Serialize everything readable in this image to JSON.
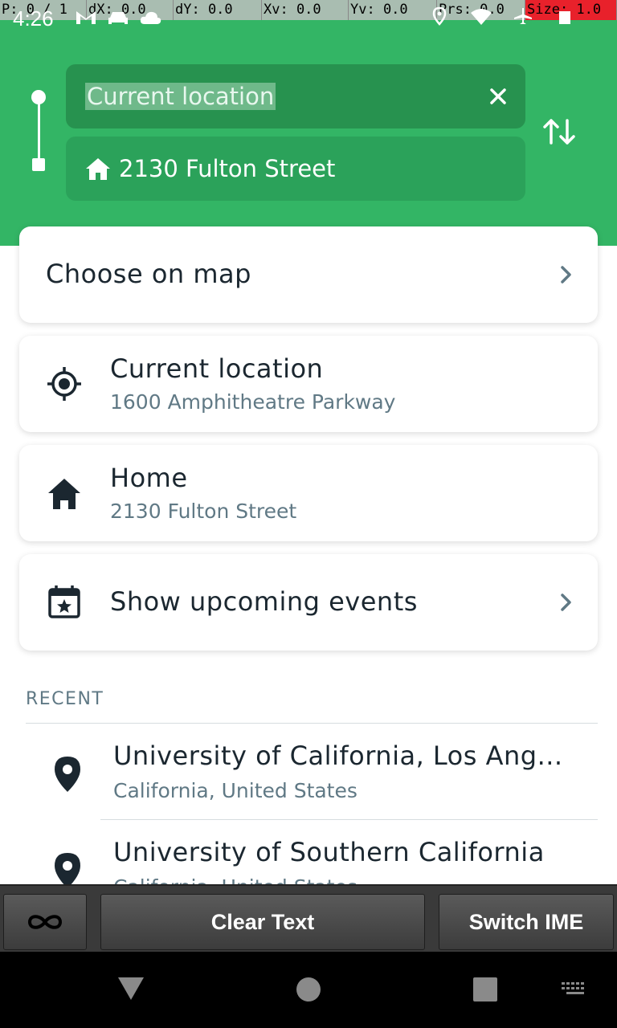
{
  "debug": {
    "pointer": "P: 0 / 1",
    "dx": "dX: 0.0",
    "dy": "dY: 0.0",
    "xv": "Xv: 0.0",
    "yv": "Yv: 0.0",
    "prs": "Prs: 0.0",
    "size": "Size: 1.0"
  },
  "status": {
    "time": "4:26"
  },
  "search": {
    "origin_value": "Current location",
    "destination_value": "2130 Fulton Street"
  },
  "cards": {
    "choose_on_map": "Choose on map",
    "current_location": {
      "title": "Current location",
      "subtitle": "1600 Amphitheatre Parkway"
    },
    "home": {
      "title": "Home",
      "subtitle": "2130 Fulton Street"
    },
    "events": "Show upcoming events"
  },
  "recent": {
    "header": "RECENT",
    "items": [
      {
        "title": "University of California, Los Ang...",
        "subtitle": "California, United States"
      },
      {
        "title": "University of Southern California",
        "subtitle": "California, United States"
      }
    ]
  },
  "ime": {
    "clear_text": "Clear Text",
    "switch_ime": "Switch IME"
  },
  "colors": {
    "header_green": "#33b565",
    "field_dark": "#27924f",
    "text_primary": "#1b2730",
    "text_secondary": "#607985"
  }
}
